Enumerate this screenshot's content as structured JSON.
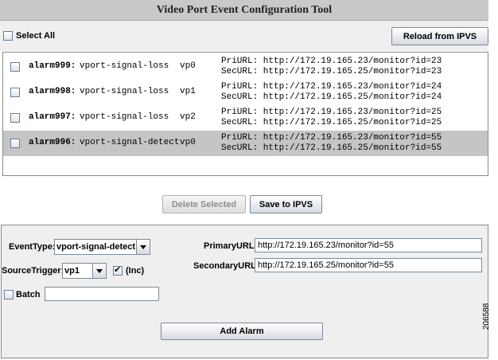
{
  "app": {
    "title": "Video Port Event Configuration Tool"
  },
  "toolbar": {
    "select_all_label": "Select All",
    "reload_label": "Reload from IPVS"
  },
  "alarms": [
    {
      "name": "alarm999:",
      "event": "vport-signal-loss",
      "port": "vp0",
      "pri": "PriURL: http://172.19.165.23/monitor?id=23",
      "sec": "SecURL: http://172.19.165.25/monitor?id=23",
      "selected": false
    },
    {
      "name": "alarm998:",
      "event": "vport-signal-loss",
      "port": "vp1",
      "pri": "PriURL: http://172.19.165.23/monitor?id=24",
      "sec": "SecURL: http://172.19.165.25/monitor?id=24",
      "selected": false
    },
    {
      "name": "alarm997:",
      "event": "vport-signal-loss",
      "port": "vp2",
      "pri": "PriURL: http://172.19.165.23/monitor?id=25",
      "sec": "SecURL: http://172.19.165.25/monitor?id=25",
      "selected": false
    },
    {
      "name": "alarm996:",
      "event": "vport-signal-detect",
      "port": "vp0",
      "pri": "PriURL: http://172.19.165.23/monitor?id=55",
      "sec": "SecURL: http://172.19.165.25/monitor?id=55",
      "selected": true
    }
  ],
  "actions": {
    "delete_label": "Delete Selected",
    "save_label": "Save to IPVS"
  },
  "form": {
    "event_type_label": "EventType:",
    "event_type_value": "vport-signal-detect",
    "source_trigger_label": "SourceTrigger:",
    "source_trigger_value": "vp1",
    "inc_label": "(Inc)",
    "inc_checked": true,
    "batch_label": "Batch",
    "batch_checked": false,
    "batch_value": "",
    "primary_url_label": "PrimaryURL:",
    "primary_url_value": "http://172.19.165.23/monitor?id=55",
    "secondary_url_label": "SecondaryURL:",
    "secondary_url_value": "http://172.19.165.25/monitor?id=55",
    "add_alarm_label": "Add Alarm"
  },
  "figure_number": "206588",
  "icons": {
    "checkbox": "checkbox-icon",
    "check": "check-icon",
    "dropdown": "chevron-down-icon"
  }
}
